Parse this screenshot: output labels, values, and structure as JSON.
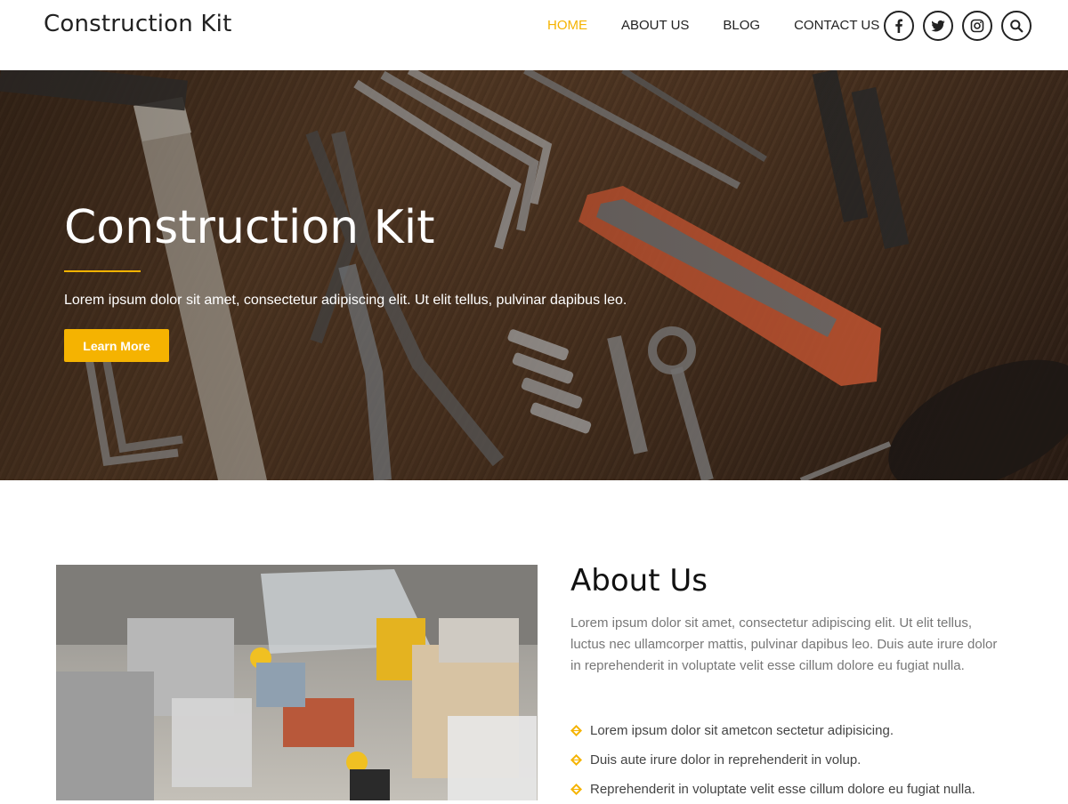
{
  "header": {
    "logo": "Construction Kit",
    "nav": [
      {
        "label": "HOME",
        "active": true
      },
      {
        "label": "ABOUT US",
        "active": false
      },
      {
        "label": "BLOG",
        "active": false
      },
      {
        "label": "CONTACT US",
        "active": false
      }
    ],
    "socials": [
      "facebook-icon",
      "twitter-icon",
      "instagram-icon",
      "search-icon"
    ]
  },
  "hero": {
    "title": "Construction Kit",
    "subtitle": "Lorem ipsum dolor sit amet, consectetur adipiscing elit. Ut elit tellus, pulvinar dapibus leo.",
    "button_label": "Learn More"
  },
  "about": {
    "title": "About Us",
    "text": "Lorem ipsum dolor sit amet, consectetur adipiscing elit. Ut elit tellus, luctus nec ullamcorper mattis, pulvinar dapibus leo. Duis aute irure dolor in reprehenderit in voluptate velit esse cillum dolore eu fugiat nulla.",
    "list": [
      "Lorem ipsum dolor sit ametcon sectetur adipisicing.",
      "Duis aute irure dolor in reprehenderit in volup.",
      "Reprehenderit in voluptate velit esse cillum dolore eu fugiat nulla."
    ]
  },
  "colors": {
    "accent": "#f5b301",
    "text_dark": "#222222",
    "text_muted": "#777777"
  }
}
